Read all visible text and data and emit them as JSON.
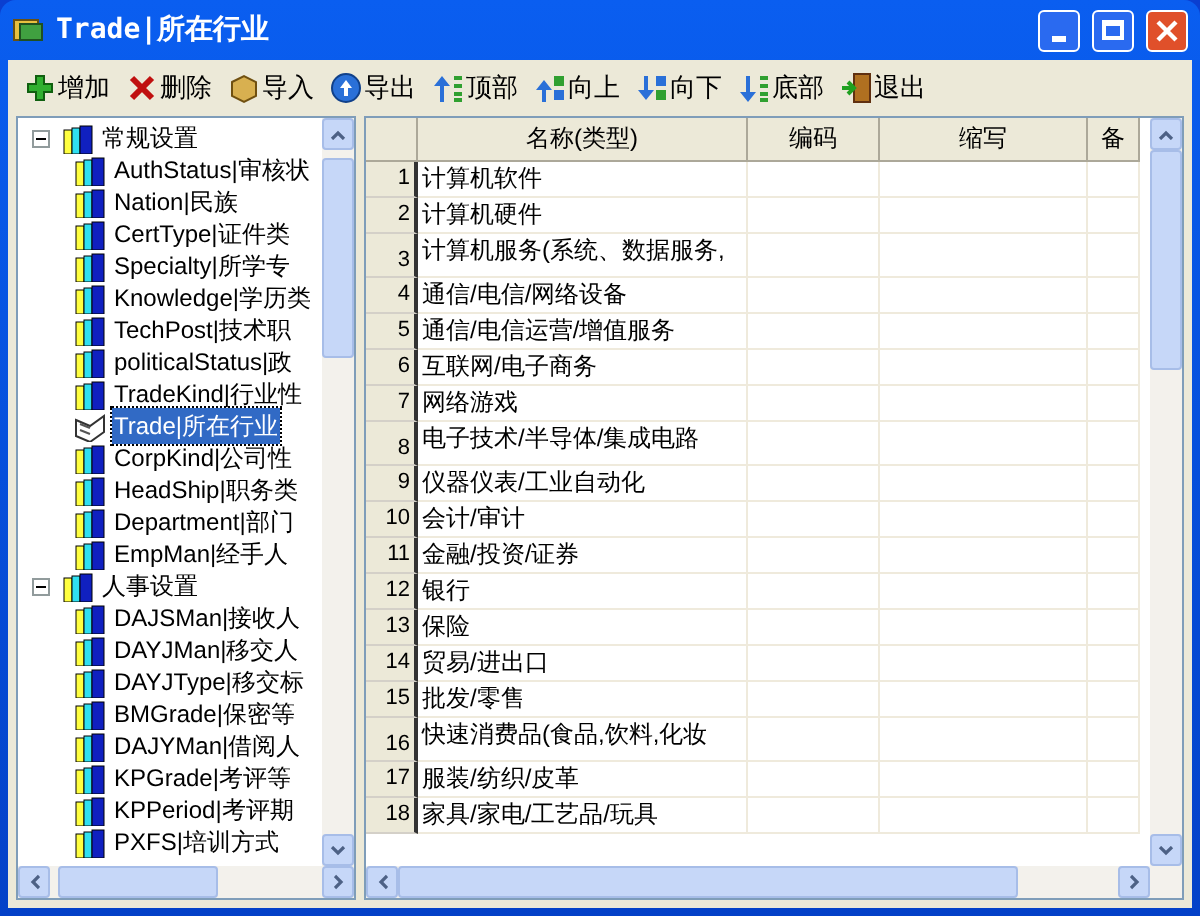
{
  "window": {
    "title": "Trade|所在行业"
  },
  "toolbar": [
    {
      "kind": "add",
      "label": "增加"
    },
    {
      "kind": "delete",
      "label": "删除"
    },
    {
      "kind": "import",
      "label": "导入"
    },
    {
      "kind": "export",
      "label": "导出"
    },
    {
      "kind": "top",
      "label": "顶部"
    },
    {
      "kind": "up",
      "label": "向上"
    },
    {
      "kind": "down",
      "label": "向下"
    },
    {
      "kind": "bottom",
      "label": "底部"
    },
    {
      "kind": "exit",
      "label": "退出"
    }
  ],
  "tree": [
    {
      "label": "常规设置",
      "expanded": true,
      "children": [
        {
          "label": "AuthStatus|审核状",
          "selected": false
        },
        {
          "label": "Nation|民族",
          "selected": false
        },
        {
          "label": "CertType|证件类",
          "selected": false
        },
        {
          "label": "Specialty|所学专",
          "selected": false
        },
        {
          "label": "Knowledge|学历类",
          "selected": false
        },
        {
          "label": "TechPost|技术职",
          "selected": false
        },
        {
          "label": "politicalStatus|政",
          "selected": false
        },
        {
          "label": "TradeKind|行业性",
          "selected": false
        },
        {
          "label": "Trade|所在行业",
          "selected": true
        },
        {
          "label": "CorpKind|公司性",
          "selected": false
        },
        {
          "label": "HeadShip|职务类",
          "selected": false
        },
        {
          "label": "Department|部门",
          "selected": false
        },
        {
          "label": "EmpMan|经手人",
          "selected": false
        }
      ]
    },
    {
      "label": "人事设置",
      "expanded": true,
      "children": [
        {
          "label": "DAJSMan|接收人",
          "selected": false
        },
        {
          "label": "DAYJMan|移交人",
          "selected": false
        },
        {
          "label": "DAYJType|移交标",
          "selected": false
        },
        {
          "label": "BMGrade|保密等",
          "selected": false
        },
        {
          "label": "DAJYMan|借阅人",
          "selected": false
        },
        {
          "label": "KPGrade|考评等",
          "selected": false
        },
        {
          "label": "KPPeriod|考评期",
          "selected": false
        },
        {
          "label": "PXFS|培训方式",
          "selected": false
        }
      ]
    }
  ],
  "table": {
    "columns": [
      "名称(类型)",
      "编码",
      "缩写",
      "备"
    ],
    "rows": [
      {
        "number": "1",
        "name": "计算机软件"
      },
      {
        "number": "2",
        "name": "计算机硬件"
      },
      {
        "number": "3",
        "name": "计算机服务(系统、数据服务,"
      },
      {
        "number": "4",
        "name": "通信/电信/网络设备"
      },
      {
        "number": "5",
        "name": "通信/电信运营/增值服务"
      },
      {
        "number": "6",
        "name": "互联网/电子商务"
      },
      {
        "number": "7",
        "name": "网络游戏"
      },
      {
        "number": "8",
        "name": "电子技术/半导体/集成电路"
      },
      {
        "number": "9",
        "name": "仪器仪表/工业自动化"
      },
      {
        "number": "10",
        "name": "会计/审计"
      },
      {
        "number": "11",
        "name": "金融/投资/证券"
      },
      {
        "number": "12",
        "name": "银行"
      },
      {
        "number": "13",
        "name": "保险"
      },
      {
        "number": "14",
        "name": "贸易/进出口"
      },
      {
        "number": "15",
        "name": "批发/零售"
      },
      {
        "number": "16",
        "name": "快速消费品(食品,饮料,化妆"
      },
      {
        "number": "17",
        "name": "服装/纺织/皮革"
      },
      {
        "number": "18",
        "name": "家具/家电/工艺品/玩具"
      }
    ]
  }
}
